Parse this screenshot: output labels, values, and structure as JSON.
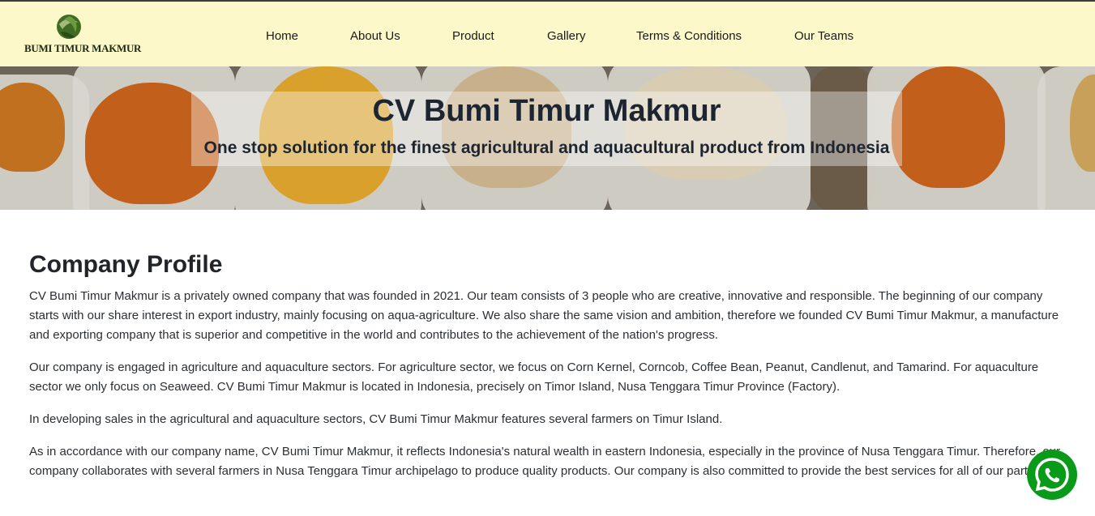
{
  "brand": {
    "logo_text": "BUMI TIMUR MAKMUR"
  },
  "nav": {
    "items": [
      {
        "label": "Home"
      },
      {
        "label": "About Us"
      },
      {
        "label": "Product"
      },
      {
        "label": "Gallery"
      },
      {
        "label": "Terms & Conditions"
      },
      {
        "label": "Our Teams"
      }
    ]
  },
  "hero": {
    "title": "CV Bumi Timur Makmur",
    "subtitle": "One stop solution for the finest agricultural and aquacultural product from Indonesia"
  },
  "profile": {
    "heading": "Company Profile",
    "paragraphs": [
      "CV Bumi Timur Makmur is a privately owned company that was founded in 2021. Our team consists of 3 people who are creative, innovative and responsible. The beginning of our company starts with our share interest in export industry, mainly focusing on aqua-agriculture. We also share the same vision and ambition, therefore we founded CV Bumi Timur Makmur, a manufacture and exporting company that is superior and competitive in the world and contributes to the achievement of the nation's progress.",
      "Our company is engaged in agriculture and aquaculture sectors. For agriculture sector, we focus on Corn Kernel, Corncob, Coffee Bean, Peanut, Candlenut, and Tamarind. For aquaculture sector we only focus on Seaweed. CV Bumi Timur Makmur is located in Indonesia, precisely on Timor Island, Nusa Tenggara Timur Province (Factory).",
      "In developing sales in the agricultural and aquaculture sectors, CV Bumi Timur Makmur features several farmers on Timur Island.",
      "As in accordance with our company name, CV Bumi Timur Makmur, it reflects Indonesia's natural wealth in eastern Indonesia, especially in the province of Nusa Tenggara Timur. Therefore, our company collaborates with several farmers in Nusa Tenggara Timur archipelago to produce quality products. Our company is also committed to provide the best services for all of our partners."
    ]
  },
  "colors": {
    "navbar_bg": "#fdf8c9",
    "whatsapp_green": "#0a9a1a",
    "logo_green": "#3f6b24"
  },
  "icons": {
    "logo": "globe-leaf-icon",
    "whatsapp": "whatsapp-icon"
  }
}
